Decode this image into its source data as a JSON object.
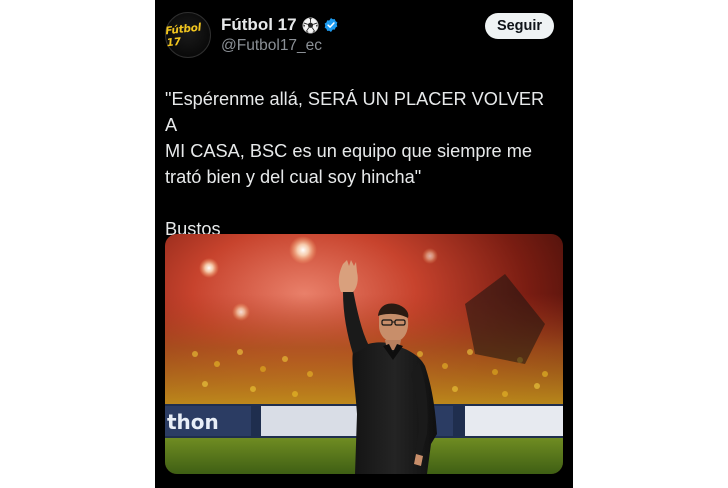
{
  "account": {
    "display_name": "Fútbol 17",
    "handle": "@Futbol17_ec",
    "avatar_text": "Fútbol 17",
    "name_emoji": "soccer-ball-icon",
    "verified": "verified-badge-icon"
  },
  "follow_button": {
    "label": "Seguir"
  },
  "tweet": {
    "text": "\"Espérenme allá, SERÁ UN PLACER VOLVER A\nMI CASA, BSC es un equipo que siempre me\ntrató bien y del cual soy hincha\"\n\nBustos"
  },
  "media": {
    "description_icon": "photo",
    "banner_left_text": "thon"
  },
  "colors": {
    "background": "#000000",
    "text": "#e7e9ea",
    "secondary_text": "#8b9096",
    "verified": "#1d9bf0",
    "button_bg": "#eff3f4"
  }
}
